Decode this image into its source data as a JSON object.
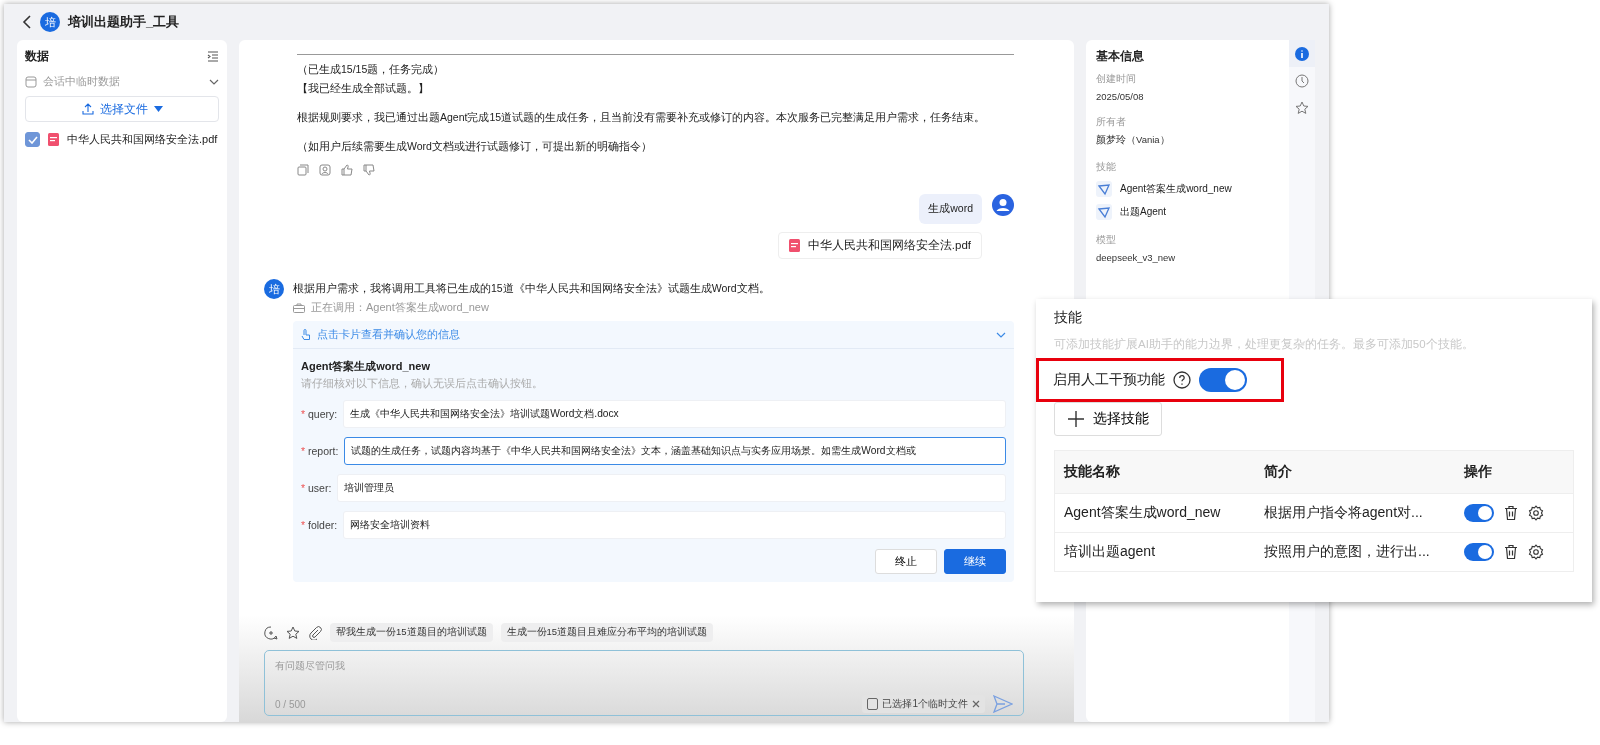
{
  "header": {
    "avatar": "培",
    "title": "培训出题助手_工具"
  },
  "data_panel": {
    "title": "数据",
    "source": "会话中临时数据",
    "upload_button": "选择文件",
    "files": [
      {
        "name": "中华人民共和国网络安全法.pdf",
        "checked": true
      }
    ]
  },
  "chat": {
    "previous_lines": [
      "（已生成15/15题，任务完成）",
      "【我已经生成全部试题。】",
      "根据规则要求，我已通过出题Agent完成15道试题的生成任务，且当前没有需要补充或修订的内容。本次服务已完整满足用户需求，任务结束。",
      "（如用户后续需要生成Word文档或进行试题修订，可提出新的明确指令）"
    ],
    "user_message": {
      "text": "生成word",
      "attachment": "中华人民共和国网络安全法.pdf"
    },
    "reply": {
      "avatar": "培",
      "text": "根据用户需求，我将调用工具将已生成的15道《中华人民共和国网络安全法》试题生成Word文档。",
      "status": "正在调用：Agent答案生成word_new",
      "card": {
        "header": "点击卡片查看并确认您的信息",
        "title": "Agent答案生成word_new",
        "hint": "请仔细核对以下信息，确认无误后点击确认按钮。",
        "fields": [
          {
            "required_mark": "*",
            "label": "query:",
            "value": "生成《中华人民共和国网络安全法》培训试题Word文档.docx",
            "focused": false
          },
          {
            "required_mark": "*",
            "label": "report:",
            "value": "试题的生成任务，试题内容均基于《中华人民共和国网络安全法》文本，涵盖基础知识点与实务应用场景。如需生成Word文档或",
            "focused": true
          },
          {
            "required_mark": "*",
            "label": "user:",
            "value": "培训管理员",
            "focused": false
          },
          {
            "required_mark": "*",
            "label": "folder:",
            "value": "网络安全培训资料",
            "focused": false
          }
        ],
        "buttons": [
          {
            "label": "终止",
            "primary": false
          },
          {
            "label": "继续",
            "primary": true
          }
        ]
      }
    }
  },
  "composer": {
    "suggestions": [
      "帮我生成一份15道题目的培训试题",
      "生成一份15道题目且难应分布平均的培训试题"
    ],
    "placeholder": "有问题尽管问我",
    "counter": "0 / 500",
    "file_chip": "已选择1个临时文件"
  },
  "info_panel": {
    "title": "基本信息",
    "created_label": "创建时间",
    "created": "2025/05/08",
    "owner_label": "所有者",
    "owner": "颜梦玲（Vania）",
    "skills_label": "技能",
    "skills": [
      "Agent答案生成word_new",
      "出题Agent"
    ],
    "model_label": "模型",
    "model": "deepseek_v3_new",
    "side_tabs": [
      {
        "kind": "info",
        "selected": true
      },
      {
        "kind": "history",
        "selected": false
      },
      {
        "kind": "favorite",
        "selected": false
      }
    ]
  },
  "skills_popup": {
    "title": "技能",
    "description": "可添加技能扩展AI助手的能力边界，处理更复杂的任务。最多可添加50个技能。",
    "intervention_label": "启用人工干预功能",
    "intervention_on": true,
    "highlighted": true,
    "add_button": "选择技能",
    "columns": [
      "技能名称",
      "简介",
      "操作"
    ],
    "rows": [
      {
        "name": "Agent答案生成word_new",
        "summary": "根据用户指令将agent对...",
        "enabled": true
      },
      {
        "name": "培训出题agent",
        "summary": "按照用户的意图，进行出...",
        "enabled": true
      }
    ]
  }
}
